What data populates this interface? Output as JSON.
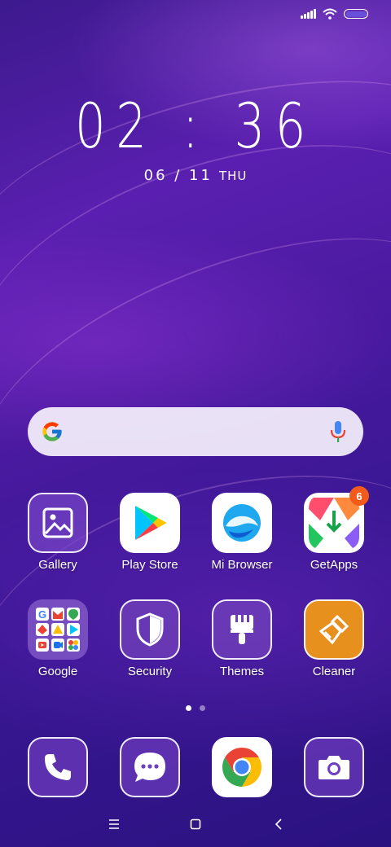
{
  "status_bar": {
    "signal_icon": "signal-icon",
    "wifi_icon": "wifi-icon",
    "battery_icon": "battery-icon"
  },
  "lock": {
    "time": "02 : 36",
    "date": "06 / 11",
    "day": "THU"
  },
  "search": {
    "logo_icon": "google-g-icon",
    "mic_icon": "microphone-icon"
  },
  "apps_row1": [
    {
      "label": "Gallery",
      "icon": "gallery-icon"
    },
    {
      "label": "Play Store",
      "icon": "play-store-icon"
    },
    {
      "label": "Mi Browser",
      "icon": "mi-browser-icon"
    },
    {
      "label": "GetApps",
      "icon": "getapps-icon",
      "badge": "6"
    }
  ],
  "apps_row2": [
    {
      "label": "Google",
      "icon": "google-folder-icon"
    },
    {
      "label": "Security",
      "icon": "shield-icon"
    },
    {
      "label": "Themes",
      "icon": "brush-icon"
    },
    {
      "label": "Cleaner",
      "icon": "broom-icon"
    }
  ],
  "page_indicator": {
    "pages": 2,
    "active": 0
  },
  "dock": [
    {
      "name": "phone",
      "icon": "phone-icon"
    },
    {
      "name": "messages",
      "icon": "messages-icon"
    },
    {
      "name": "chrome",
      "icon": "chrome-icon"
    },
    {
      "name": "camera",
      "icon": "camera-icon"
    }
  ],
  "nav": {
    "menu_icon": "menu-icon",
    "home_icon": "home-icon",
    "back_icon": "back-icon"
  },
  "colors": {
    "badge": "#f25b1a",
    "cleaner": "#e8901e",
    "accent_purple": "#5a1fb0"
  }
}
